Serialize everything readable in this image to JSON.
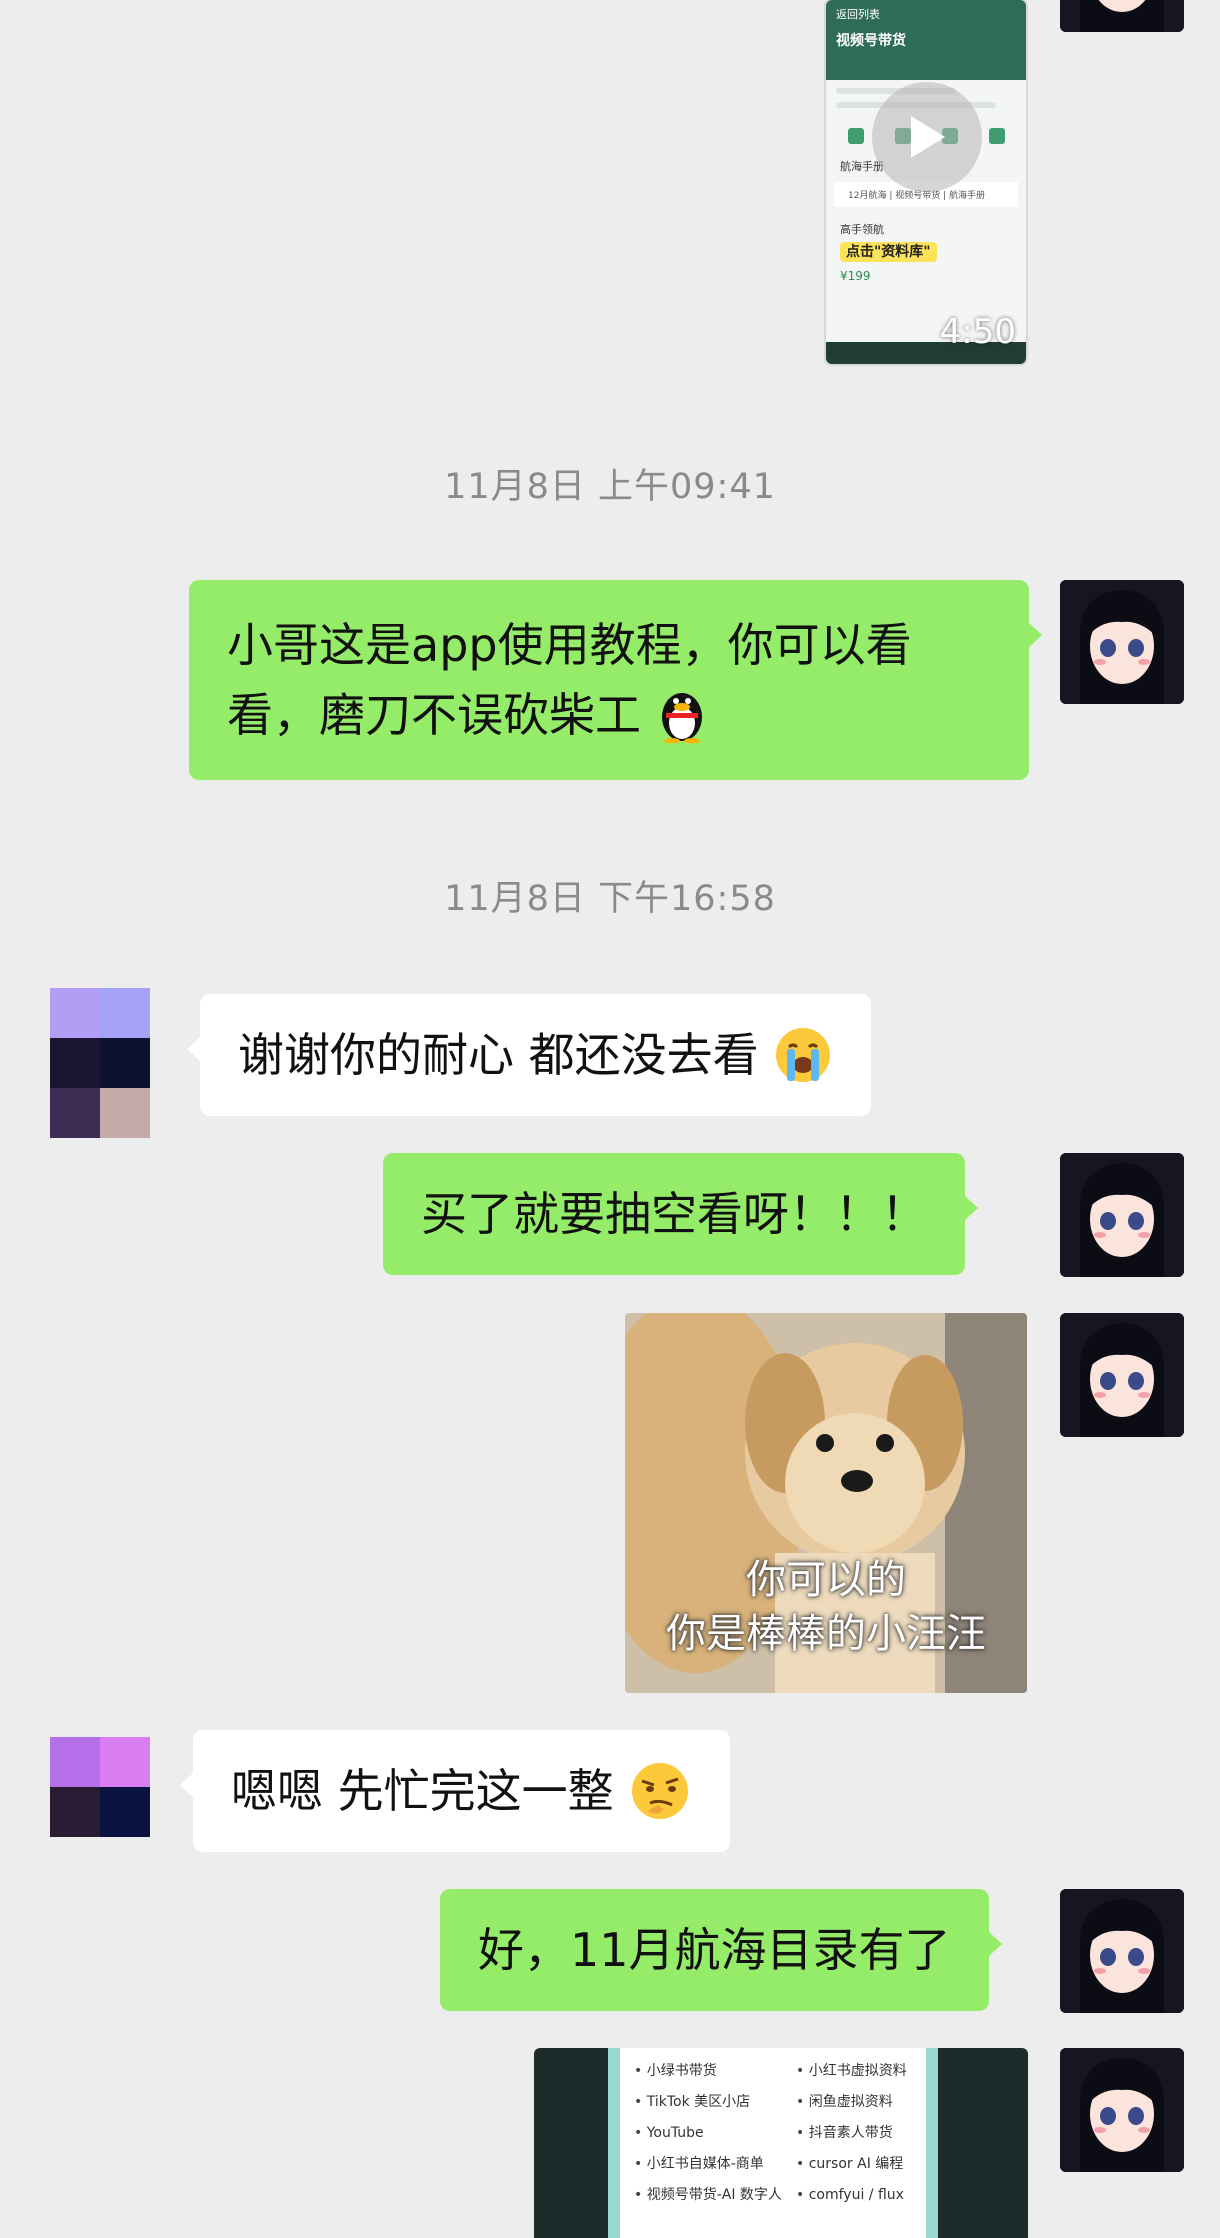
{
  "colors": {
    "background": "#ededed",
    "bubble_mine": "#95ec69",
    "bubble_theirs": "#ffffff",
    "timestamp_text": "#8a8a8a"
  },
  "video_message": {
    "back_label": "返回列表",
    "title": "视频号带货",
    "menu_item": "航海手册",
    "menu_subitems": "12月航海 | 视频号带货 | 航海手册",
    "section_label": "高手领航",
    "callout_text": "点击\"资料库\"",
    "price": "¥199",
    "duration": "4:50",
    "play_icon": "play-icon"
  },
  "timestamps": [
    "11月8日 上午09:41",
    "11月8日 下午16:58"
  ],
  "messages": [
    {
      "from": "me",
      "lines": [
        "小哥这是app使用教程，你可以看",
        "看，磨刀不误砍柴工"
      ],
      "emoji": "qq-penguin-icon"
    },
    {
      "from": "them",
      "text": "谢谢你的耐心  都还没去看",
      "emoji": "crying-face-icon"
    },
    {
      "from": "me",
      "text": "买了就要抽空看呀！！！"
    },
    {
      "from": "me",
      "type": "sticker",
      "caption_lines": [
        "你可以的",
        "你是棒棒的小汪汪"
      ]
    },
    {
      "from": "them",
      "text": "嗯嗯 先忙完这一整",
      "emoji": "thinking-face-icon"
    },
    {
      "from": "me",
      "text": "好，11月航海目录有了"
    }
  ],
  "doc_preview": {
    "left_items": [
      "小绿书带货",
      "TikTok 美区小店",
      "YouTube",
      "小红书自媒体-商单",
      "视频号带货-AI 数字人"
    ],
    "right_items": [
      "小红书虚拟资料",
      "闲鱼虚拟资料",
      "抖音素人带货",
      "cursor AI 编程",
      "comfyui / flux"
    ]
  }
}
